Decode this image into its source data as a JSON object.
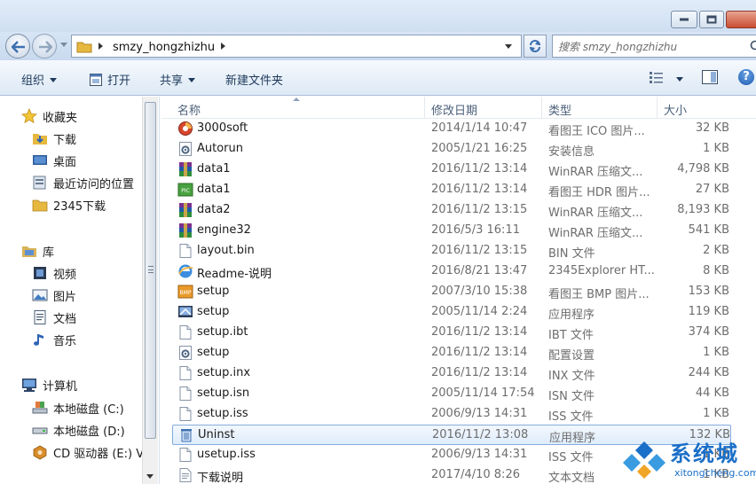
{
  "address": {
    "path_segment": "smzy_hongzhizhu",
    "search_placeholder": "搜索 smzy_hongzhizhu"
  },
  "toolbar": {
    "organize_label": "组织",
    "open_label": "打开",
    "share_label": "共享",
    "new_folder_label": "新建文件夹",
    "help_label": "?"
  },
  "nav": {
    "favorites": "收藏夹",
    "downloads": "下载",
    "desktop": "桌面",
    "recent": "最近访问的位置",
    "dl2345": "2345下载",
    "libraries": "库",
    "videos": "视频",
    "pictures": "图片",
    "documents": "文档",
    "music": "音乐",
    "computer": "计算机",
    "drive_c": "本地磁盘 (C:)",
    "drive_d": "本地磁盘 (D:)",
    "drive_e": "CD 驱动器 (E:) V"
  },
  "columns": {
    "name": "名称",
    "modified": "修改日期",
    "type": "类型",
    "size": "大小"
  },
  "files": [
    {
      "name": "3000soft",
      "date": "2014/1/14 10:47",
      "type": "看图王 ICO 图片...",
      "size": "32 KB",
      "icon": "ico-image-icon"
    },
    {
      "name": "Autorun",
      "date": "2005/1/21 16:25",
      "type": "安装信息",
      "size": "1 KB",
      "icon": "settings-file-icon"
    },
    {
      "name": "data1",
      "date": "2016/11/2 13:14",
      "type": "WinRAR 压缩文...",
      "size": "4,798 KB",
      "icon": "winrar-icon"
    },
    {
      "name": "data1",
      "date": "2016/11/2 13:14",
      "type": "看图王 HDR 图片...",
      "size": "27 KB",
      "icon": "hdr-image-icon"
    },
    {
      "name": "data2",
      "date": "2016/11/2 13:15",
      "type": "WinRAR 压缩文...",
      "size": "8,193 KB",
      "icon": "winrar-icon"
    },
    {
      "name": "engine32",
      "date": "2016/5/3 16:11",
      "type": "WinRAR 压缩文...",
      "size": "541 KB",
      "icon": "winrar-icon"
    },
    {
      "name": "layout.bin",
      "date": "2016/11/2 13:15",
      "type": "BIN 文件",
      "size": "2 KB",
      "icon": "blank-file-icon"
    },
    {
      "name": "Readme-说明",
      "date": "2016/8/21 13:47",
      "type": "2345Explorer HT...",
      "size": "8 KB",
      "icon": "browser-html-icon"
    },
    {
      "name": "setup",
      "date": "2007/3/10 15:38",
      "type": "看图王 BMP 图片...",
      "size": "153 KB",
      "icon": "bmp-image-icon"
    },
    {
      "name": "setup",
      "date": "2005/11/14 2:24",
      "type": "应用程序",
      "size": "119 KB",
      "icon": "setup-exe-icon"
    },
    {
      "name": "setup.ibt",
      "date": "2016/11/2 13:14",
      "type": "IBT 文件",
      "size": "374 KB",
      "icon": "blank-file-icon"
    },
    {
      "name": "setup",
      "date": "2016/11/2 13:14",
      "type": "配置设置",
      "size": "1 KB",
      "icon": "settings-file-icon"
    },
    {
      "name": "setup.inx",
      "date": "2016/11/2 13:14",
      "type": "INX 文件",
      "size": "244 KB",
      "icon": "blank-file-icon"
    },
    {
      "name": "setup.isn",
      "date": "2005/11/14 17:54",
      "type": "ISN 文件",
      "size": "44 KB",
      "icon": "blank-file-icon"
    },
    {
      "name": "setup.iss",
      "date": "2006/9/13 14:31",
      "type": "ISS 文件",
      "size": "1 KB",
      "icon": "blank-file-icon"
    },
    {
      "name": "Uninst",
      "date": "2016/11/2 13:08",
      "type": "应用程序",
      "size": "132 KB",
      "icon": "uninstall-icon",
      "selected": true
    },
    {
      "name": "usetup.iss",
      "date": "2006/9/13 14:31",
      "type": "ISS 文件",
      "size": "1 KB",
      "icon": "blank-file-icon"
    },
    {
      "name": "下载说明",
      "date": "2017/4/10 8:26",
      "type": "文本文档",
      "size": "1 KB",
      "icon": "text-file-icon"
    }
  ],
  "watermark": {
    "brand": "系统城",
    "domain": "xitongcheng.com"
  },
  "colors": {
    "selection": "#dfecfb",
    "selection_border": "#84acdd",
    "header_text": "#4c607a",
    "accent": "#1a6fc8"
  }
}
